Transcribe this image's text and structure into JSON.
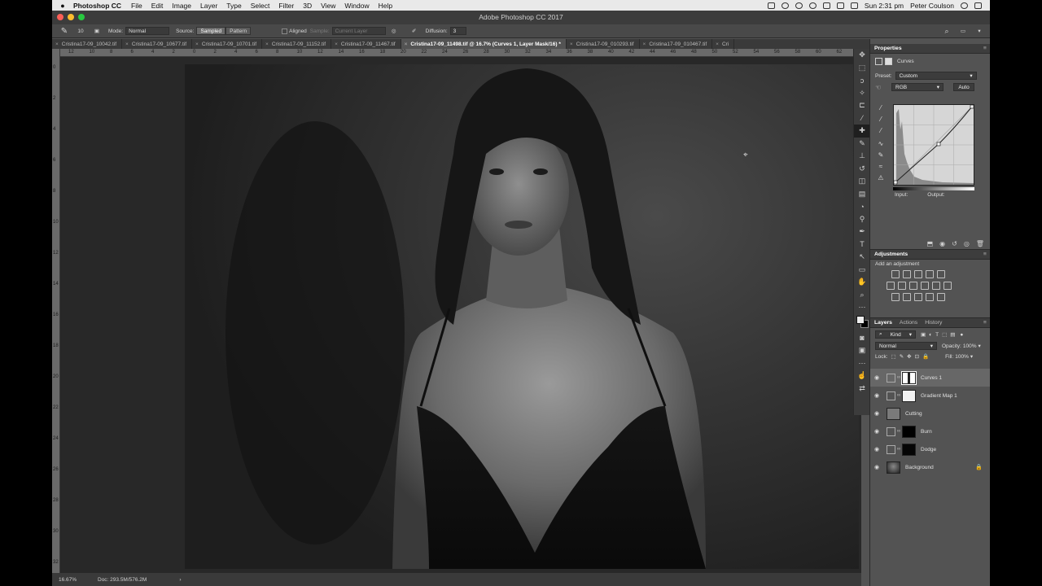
{
  "menubar": {
    "app_name": "Photoshop CC",
    "items": [
      "File",
      "Edit",
      "Image",
      "Layer",
      "Type",
      "Select",
      "Filter",
      "3D",
      "View",
      "Window",
      "Help"
    ],
    "clock": "Sun 2:31 pm",
    "user": "Peter Coulson"
  },
  "window": {
    "title": "Adobe Photoshop CC 2017"
  },
  "options": {
    "brush_size": "10",
    "mode_label": "Mode:",
    "mode_value": "Normal",
    "source_label": "Source:",
    "source_sampled": "Sampled",
    "source_pattern": "Pattern",
    "aligned_label": "Aligned",
    "sample_label": "Sample:",
    "sample_value": "Current Layer",
    "diffusion_label": "Diffusion:",
    "diffusion_value": "3"
  },
  "tabs": [
    {
      "label": "Cristina17-09_10042.tif",
      "active": false
    },
    {
      "label": "Cristina17-09_10677.tif",
      "active": false
    },
    {
      "label": "Cristina17-09_10701.tif",
      "active": false
    },
    {
      "label": "Cristina17-09_11152.tif",
      "active": false
    },
    {
      "label": "Cristina17-09_11467.tif",
      "active": false
    },
    {
      "label": "Cristina17-09_11498.tif @ 16.7% (Curves 1, Layer Mask/16) *",
      "active": true
    },
    {
      "label": "Cristina17-09_010293.tif",
      "active": false
    },
    {
      "label": "Cristina17-09_010467.tif",
      "active": false
    },
    {
      "label": "Cri",
      "active": false
    }
  ],
  "ruler": {
    "h_numbers": [
      "12",
      "10",
      "8",
      "6",
      "4",
      "2",
      "0",
      "2",
      "4",
      "6",
      "8",
      "10",
      "12",
      "14",
      "16",
      "18",
      "20",
      "22",
      "24",
      "26",
      "28",
      "30",
      "32",
      "34",
      "36",
      "38",
      "40",
      "42",
      "44",
      "46",
      "48",
      "50",
      "52",
      "54",
      "56",
      "58",
      "60",
      "62",
      "64",
      "66",
      "68"
    ],
    "v_numbers": [
      "0",
      "2",
      "4",
      "6",
      "8",
      "10",
      "12",
      "14",
      "16",
      "18",
      "20",
      "22",
      "24",
      "26",
      "28",
      "30",
      "32"
    ]
  },
  "status": {
    "zoom": "16.67%",
    "doc": "Doc: 293.5M/576.2M",
    "arrow": "›"
  },
  "properties": {
    "panel_title": "Properties",
    "adjustment_name": "Curves",
    "preset_label": "Preset:",
    "preset_value": "Custom",
    "channel_value": "RGB",
    "auto_label": "Auto",
    "input_label": "Input:",
    "output_label": "Output:"
  },
  "adjustments": {
    "panel_title": "Adjustments",
    "add_label": "Add an adjustment"
  },
  "layers_panel": {
    "tabs": [
      "Layers",
      "Actions",
      "History"
    ],
    "kind_label": "Kind",
    "blend_mode": "Normal",
    "opacity_label": "Opacity:",
    "opacity_value": "100%",
    "lock_label": "Lock:",
    "fill_label": "Fill:",
    "fill_value": "100%",
    "layers": [
      {
        "name": "Curves 1",
        "selected": true
      },
      {
        "name": "Gradient Map 1",
        "selected": false
      },
      {
        "name": "Cutting",
        "selected": false
      },
      {
        "name": "Burn",
        "selected": false
      },
      {
        "name": "Dodge",
        "selected": false
      },
      {
        "name": "Background",
        "selected": false
      }
    ]
  },
  "colors": {
    "panel_bg": "#535353",
    "canvas_bg": "#282828",
    "traffic_red": "#fc5f57",
    "traffic_yellow": "#fdbc2e",
    "traffic_green": "#28c840"
  }
}
